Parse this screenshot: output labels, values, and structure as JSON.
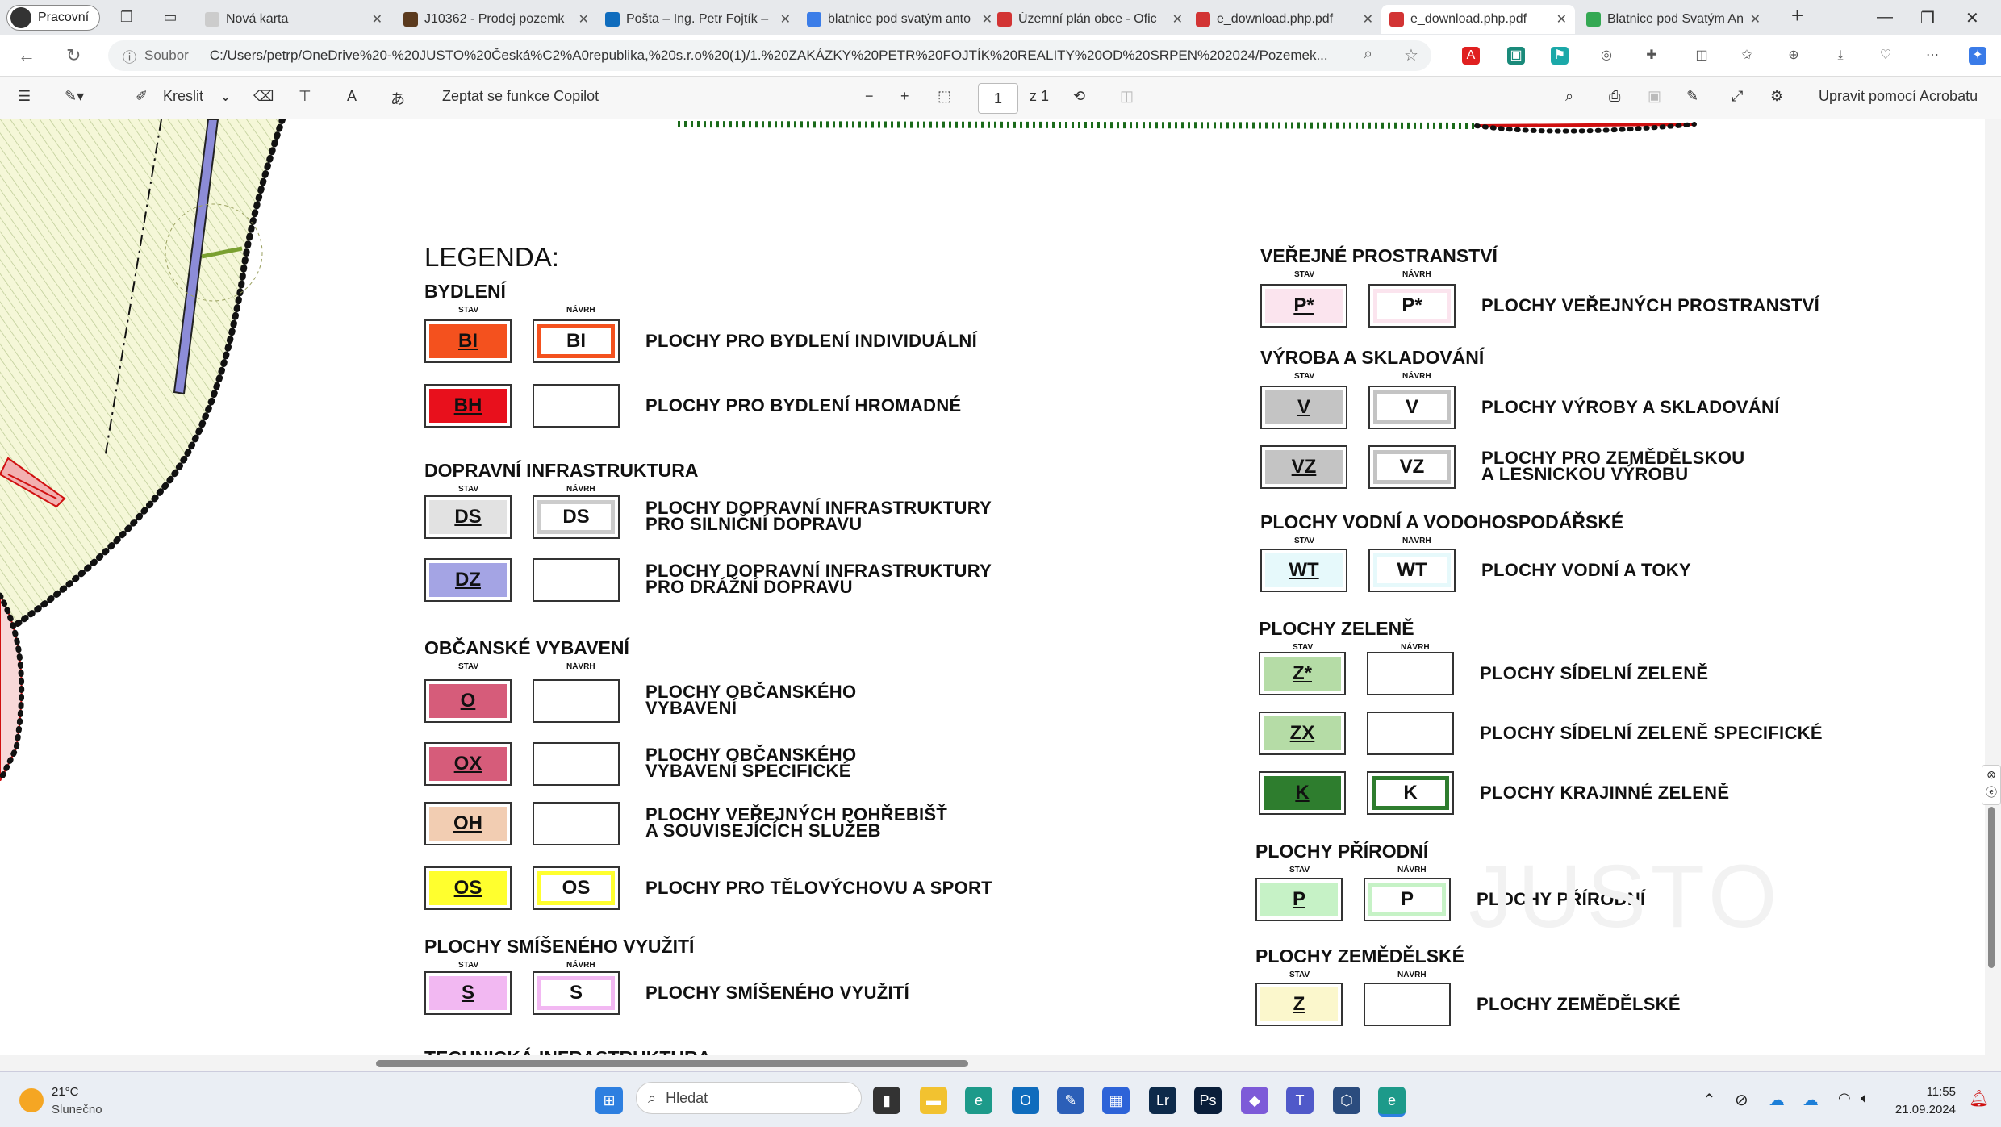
{
  "browser": {
    "profile_label": "Pracovní",
    "tabs": [
      {
        "title": "Nová karta",
        "color": "#cccccc"
      },
      {
        "title": "J10362 - Prodej pozemk",
        "color": "#5b3a1e"
      },
      {
        "title": "Pošta – Ing. Petr Fojtík –",
        "color": "#0f6cbd"
      },
      {
        "title": "blatnice pod svatým anto",
        "color": "#3b7de8"
      },
      {
        "title": "Územní plán obce - Ofic",
        "color": "#d23434"
      },
      {
        "title": "e_download.php.pdf",
        "color": "#d23434"
      },
      {
        "title": "e_download.php.pdf",
        "color": "#d23434"
      },
      {
        "title": "Blatnice pod Svatým An",
        "color": "#34a853"
      }
    ],
    "new_tab_symbol": "+",
    "address_prefix": "Soubor",
    "url": "C:/Users/petrp/OneDrive%20-%20JUSTO%20Česká%C2%A0republika,%20s.r.o%20(1)/1.%20ZAKÁZKY%20PETR%20FOJTÍK%20REALITY%20OD%20SRPEN%202024/Pozemek..."
  },
  "pdf_toolbar": {
    "draw_label": "Kreslit",
    "copilot_label": "Zeptat se funkce Copilot",
    "page_value": "1",
    "page_total": "z 1",
    "acrobat_label": "Upravit pomocí Acrobatu"
  },
  "legend": {
    "title": "LEGENDA:",
    "stav_label": "STAV",
    "navrh_label": "NÁVRH",
    "left_sections": [
      {
        "heading": "BYDLENÍ",
        "rows": [
          {
            "stav_code": "BI",
            "stav_fill": "#f4511e",
            "navrh_code": "BI",
            "navrh_border": "#f4511e",
            "navrh_fill": "#ffffff",
            "label": [
              "PLOCHY PRO BYDLENÍ INDIVIDUÁLNÍ"
            ]
          },
          {
            "stav_code": "BH",
            "stav_fill": "#e8101c",
            "navrh_code": "",
            "navrh_border": "#333333",
            "navrh_fill": "#ffffff",
            "label": [
              "PLOCHY PRO BYDLENÍ HROMADNÉ"
            ]
          }
        ]
      },
      {
        "heading": "DOPRAVNÍ INFRASTRUKTURA",
        "rows": [
          {
            "stav_code": "DS",
            "stav_fill": "#e2e2e2",
            "navrh_code": "DS",
            "navrh_border": "#cccccc",
            "navrh_fill": "#ffffff",
            "label": [
              "PLOCHY DOPRAVNÍ INFRASTRUKTURY",
              "PRO SILNIČNÍ DOPRAVU"
            ]
          },
          {
            "stav_code": "DZ",
            "stav_fill": "#a4a4e4",
            "navrh_code": "",
            "navrh_border": "#333333",
            "navrh_fill": "#ffffff",
            "label": [
              "PLOCHY DOPRAVNÍ INFRASTRUKTURY",
              "PRO DRÁŽNÍ DOPRAVU"
            ]
          }
        ]
      },
      {
        "heading": "OBČANSKÉ VYBAVENÍ",
        "rows": [
          {
            "stav_code": "O",
            "stav_fill": "#d65c7a",
            "navrh_code": "",
            "navrh_border": "#333333",
            "navrh_fill": "#ffffff",
            "label": [
              "PLOCHY OBČANSKÉHO",
              "VYBAVENÍ"
            ]
          },
          {
            "stav_code": "OX",
            "stav_fill": "#d65c7a",
            "navrh_code": "",
            "navrh_border": "#333333",
            "navrh_fill": "#ffffff",
            "label": [
              "PLOCHY OBČANSKÉHO",
              "VYBAVENÍ SPECIFICKÉ"
            ]
          },
          {
            "stav_code": "OH",
            "stav_fill": "#f2cdb2",
            "navrh_code": "",
            "navrh_border": "#333333",
            "navrh_fill": "#ffffff",
            "label": [
              "PLOCHY VEŘEJNÝCH POHŘEBIŠŤ",
              "A SOUVISEJÍCÍCH SLUŽEB"
            ]
          },
          {
            "stav_code": "OS",
            "stav_fill": "#ffff2e",
            "navrh_code": "OS",
            "navrh_border": "#ffff2e",
            "navrh_fill": "#ffffff",
            "label": [
              "PLOCHY PRO TĚLOVÝCHOVU A SPORT"
            ]
          }
        ]
      },
      {
        "heading": "PLOCHY SMÍŠENÉHO VYUŽITÍ",
        "rows": [
          {
            "stav_code": "S",
            "stav_fill": "#f2b8f2",
            "navrh_code": "S",
            "navrh_border": "#f2b8f2",
            "navrh_fill": "#ffffff",
            "label": [
              "PLOCHY SMÍŠENÉHO VYUŽITÍ"
            ]
          }
        ]
      },
      {
        "heading": "TECHNICKÁ INFRASTRUKTURA",
        "rows": []
      }
    ],
    "right_sections": [
      {
        "heading": "VEŘEJNÉ PROSTRANSTVÍ",
        "rows": [
          {
            "stav_code": "P*",
            "stav_fill": "#fbe4ee",
            "navrh_code": "P*",
            "navrh_border": "#fbe4ee",
            "navrh_fill": "#ffffff",
            "label": [
              "PLOCHY VEŘEJNÝCH PROSTRANSTVÍ"
            ]
          }
        ]
      },
      {
        "heading": "VÝROBA A SKLADOVÁNÍ",
        "rows": [
          {
            "stav_code": "V",
            "stav_fill": "#c4c4c4",
            "navrh_code": "V",
            "navrh_border": "#c4c4c4",
            "navrh_fill": "#ffffff",
            "label": [
              "PLOCHY VÝROBY A SKLADOVÁNÍ"
            ]
          },
          {
            "stav_code": "VZ",
            "stav_fill": "#c4c4c4",
            "navrh_code": "VZ",
            "navrh_border": "#c4c4c4",
            "navrh_fill": "#ffffff",
            "label": [
              "PLOCHY PRO ZEMĚDĚLSKOU",
              "A LESNICKOU VÝROBU"
            ]
          }
        ]
      },
      {
        "heading": "PLOCHY VODNÍ A VODOHOSPODÁŘSKÉ",
        "rows": [
          {
            "stav_code": "WT",
            "stav_fill": "#e6f9fb",
            "navrh_code": "WT",
            "navrh_border": "#e6f9fb",
            "navrh_fill": "#ffffff",
            "label": [
              "PLOCHY VODNÍ A TOKY"
            ]
          }
        ]
      },
      {
        "heading": "PLOCHY ZELENĚ",
        "rows": [
          {
            "stav_code": "Z*",
            "stav_fill": "#b5dca6",
            "navrh_code": "",
            "navrh_border": "#333333",
            "navrh_fill": "#ffffff",
            "label": [
              "PLOCHY SÍDELNÍ ZELENĚ"
            ]
          },
          {
            "stav_code": "ZX",
            "stav_fill": "#b5dca6",
            "navrh_code": "",
            "navrh_border": "#333333",
            "navrh_fill": "#ffffff",
            "label": [
              "PLOCHY SÍDELNÍ ZELENĚ SPECIFICKÉ"
            ]
          },
          {
            "stav_code": "K",
            "stav_fill": "#2e7d2e",
            "navrh_code": "K",
            "navrh_border": "#2e7d2e",
            "navrh_fill": "#ffffff",
            "label": [
              "PLOCHY KRAJINNÉ ZELENĚ"
            ]
          }
        ]
      },
      {
        "heading": "PLOCHY PŘÍRODNÍ",
        "rows": [
          {
            "stav_code": "P",
            "stav_fill": "#c6f2c6",
            "navrh_code": "P",
            "navrh_border": "#c6f2c6",
            "navrh_fill": "#ffffff",
            "label": [
              "PLOCHY PŘÍRODNÍ"
            ]
          }
        ]
      },
      {
        "heading": "PLOCHY ZEMĚDĚLSKÉ",
        "rows": [
          {
            "stav_code": "Z",
            "stav_fill": "#fbf7cc",
            "navrh_code": "",
            "navrh_border": "#333333",
            "navrh_fill": "#ffffff",
            "label": [
              "PLOCHY ZEMĚDĚLSKÉ"
            ]
          }
        ]
      }
    ],
    "watermark": "JUSTO"
  },
  "taskbar": {
    "weather_temp": "21°C",
    "weather_desc": "Slunečno",
    "search_placeholder": "Hledat",
    "time": "11:55",
    "date": "21.09.2024"
  }
}
